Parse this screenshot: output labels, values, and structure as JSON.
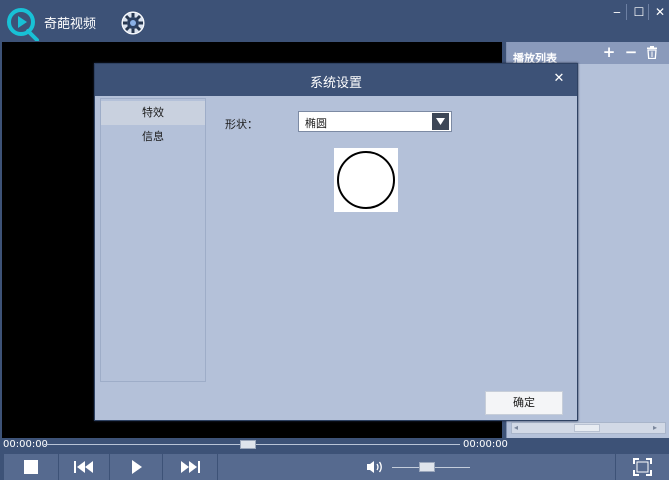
{
  "app": {
    "title": "奇葩视频"
  },
  "window_controls": {
    "minimize": "‒",
    "maximize": "☐",
    "close": "✕"
  },
  "playlist": {
    "title": "播放列表",
    "add_label": "+",
    "remove_label": "−"
  },
  "dialog": {
    "title": "系统设置",
    "close_label": "✕",
    "nav": [
      {
        "label": "特效",
        "selected": true
      },
      {
        "label": "信息",
        "selected": false
      }
    ],
    "shape": {
      "label": "形状：",
      "value": "椭圆",
      "preview_icon": "circle"
    },
    "ok_label": "确定"
  },
  "player": {
    "time_current": "00:00:00",
    "time_total": "00:00:00",
    "progress": 0.49,
    "volume": 0.45
  },
  "colors": {
    "accent": "#3d5277",
    "panel": "#b4c1d9",
    "logo": "#18c1d6"
  }
}
